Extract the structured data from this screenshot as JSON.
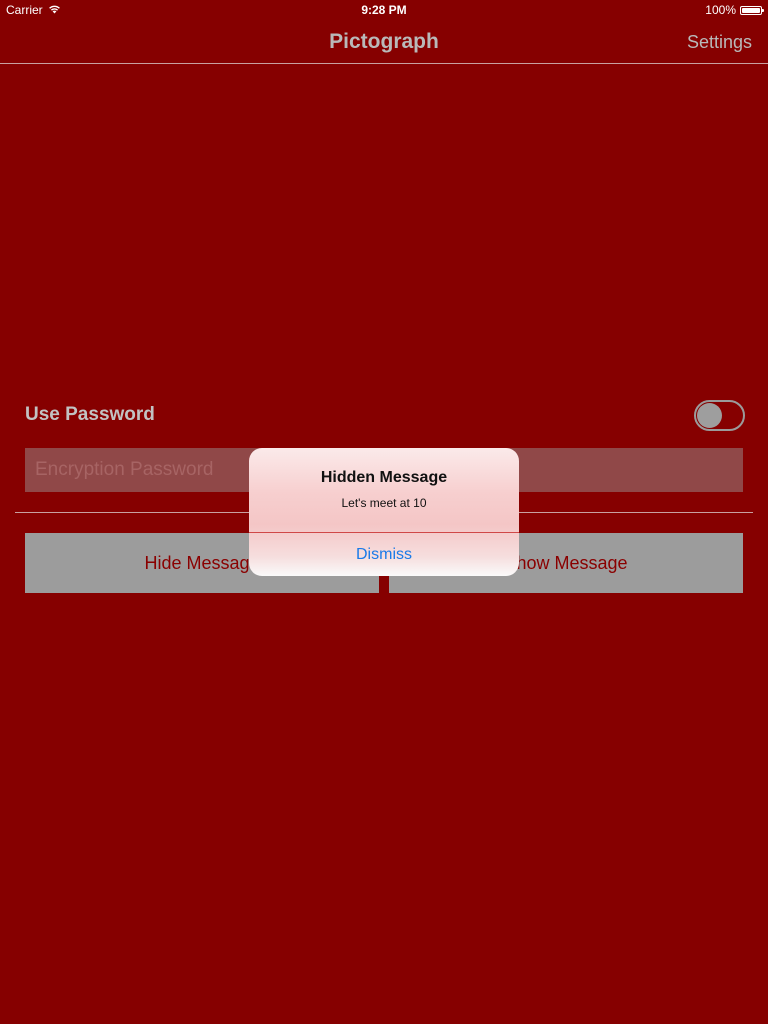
{
  "status_bar": {
    "carrier": "Carrier",
    "wifi_icon": "wifi-icon",
    "time": "9:28 PM",
    "battery_percent": "100%",
    "battery_icon": "battery-icon",
    "battery_level": 1.0
  },
  "nav": {
    "title": "Pictograph",
    "settings_label": "Settings"
  },
  "password": {
    "use_password_label": "Use Password",
    "toggle_on": false,
    "field_placeholder": "Encryption Password",
    "field_value": ""
  },
  "actions": {
    "hide_label": "Hide Message",
    "show_label": "Show Message"
  },
  "alert": {
    "title": "Hidden Message",
    "message": "Let's meet at 10",
    "dismiss_label": "Dismiss"
  },
  "colors": {
    "background": "#860000",
    "button_gray": "#9c9c9c",
    "button_text": "#8a0000",
    "alert_action": "#1a7ae8"
  }
}
